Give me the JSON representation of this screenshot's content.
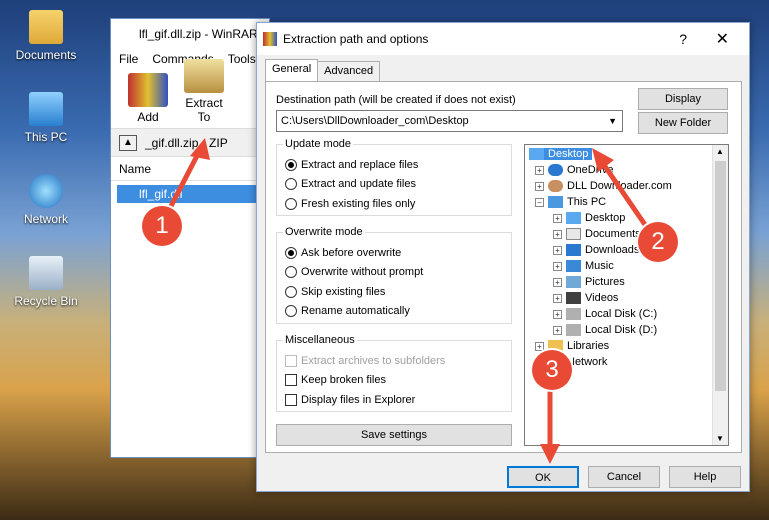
{
  "desktop": {
    "icons": [
      "Documents",
      "This PC",
      "Network",
      "Recycle Bin"
    ]
  },
  "winrar": {
    "title": "lfl_gif.dll.zip - WinRAR",
    "menu": [
      "File",
      "Commands",
      "Tools"
    ],
    "toolbar": {
      "add": "Add",
      "extract_to": "Extract To"
    },
    "path": "_gif.dll.zip - ZIP",
    "list_header": "Name",
    "selected_file": "lfl_gif.dll"
  },
  "dialog": {
    "title": "Extraction path and options",
    "help_symbol": "?",
    "close_symbol": "✕",
    "tabs": [
      "General",
      "Advanced"
    ],
    "destination_label": "Destination path (will be created if does not exist)",
    "destination_value": "C:\\Users\\DllDownloader_com\\Desktop",
    "display_button": "Display",
    "new_folder_button": "New Folder",
    "update_mode": {
      "title": "Update mode",
      "options": [
        "Extract and replace files",
        "Extract and update files",
        "Fresh existing files only"
      ],
      "selected": 0
    },
    "overwrite_mode": {
      "title": "Overwrite mode",
      "options": [
        "Ask before overwrite",
        "Overwrite without prompt",
        "Skip existing files",
        "Rename automatically"
      ],
      "selected": 0
    },
    "misc": {
      "title": "Miscellaneous",
      "options": [
        "Extract archives to subfolders",
        "Keep broken files",
        "Display files in Explorer"
      ]
    },
    "save_settings": "Save settings",
    "tree": {
      "desktop": "Desktop",
      "onedrive": "OneDrive",
      "dlldownloader": "DLL Downloader.com",
      "thispc": "This PC",
      "children": [
        "Desktop",
        "Documents",
        "Downloads",
        "Music",
        "Pictures",
        "Videos",
        "Local Disk (C:)",
        "Local Disk (D:)"
      ],
      "libraries": "Libraries",
      "network": "Network"
    },
    "ok": "OK",
    "cancel": "Cancel",
    "help": "Help"
  },
  "markers": [
    "1",
    "2",
    "3"
  ],
  "colors": {
    "marker": "#e84a36",
    "selection": "#3d8ee0"
  }
}
